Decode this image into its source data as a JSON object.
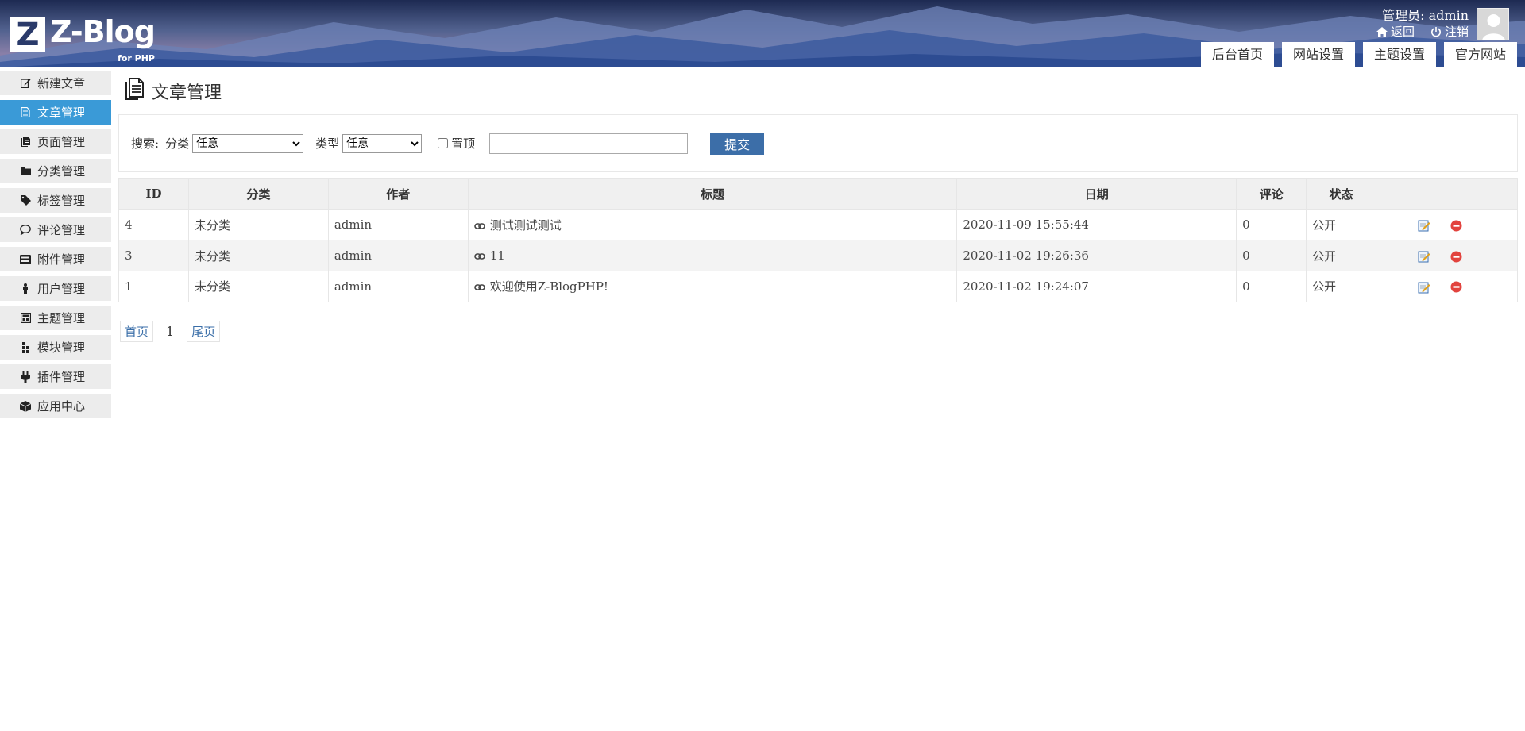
{
  "header": {
    "logo_mark": "Z",
    "logo_text": "Z-Blog",
    "logo_sub": "for PHP",
    "user_label": "管理员: admin",
    "back_label": "返回",
    "logout_label": "注销",
    "tabs": [
      "后台首页",
      "网站设置",
      "主题设置",
      "官方网站"
    ]
  },
  "sidebar": {
    "items": [
      {
        "label": "新建文章",
        "icon": "edit-icon"
      },
      {
        "label": "文章管理",
        "icon": "article-icon"
      },
      {
        "label": "页面管理",
        "icon": "page-icon"
      },
      {
        "label": "分类管理",
        "icon": "folder-icon"
      },
      {
        "label": "标签管理",
        "icon": "tag-icon"
      },
      {
        "label": "评论管理",
        "icon": "comment-icon"
      },
      {
        "label": "附件管理",
        "icon": "attachment-icon"
      },
      {
        "label": "用户管理",
        "icon": "user-icon"
      },
      {
        "label": "主题管理",
        "icon": "theme-icon"
      },
      {
        "label": "模块管理",
        "icon": "module-icon"
      },
      {
        "label": "插件管理",
        "icon": "plugin-icon"
      },
      {
        "label": "应用中心",
        "icon": "box-icon"
      }
    ],
    "active_color": "#3a9ad7"
  },
  "main": {
    "title": "文章管理",
    "search": {
      "label": "搜索:",
      "category_label": "分类",
      "category_value": "任意",
      "type_label": "类型",
      "type_value": "任意",
      "sticky_label": "置顶",
      "keyword_value": "",
      "submit_label": "提交"
    },
    "table": {
      "headers": [
        "ID",
        "分类",
        "作者",
        "标题",
        "日期",
        "评论",
        "状态",
        ""
      ],
      "rows": [
        {
          "id": "4",
          "category": "未分类",
          "author": "admin",
          "title": "测试测试测试",
          "date": "2020-11-09 15:55:44",
          "comments": "0",
          "status": "公开"
        },
        {
          "id": "3",
          "category": "未分类",
          "author": "admin",
          "title": "11",
          "date": "2020-11-02 19:26:36",
          "comments": "0",
          "status": "公开"
        },
        {
          "id": "1",
          "category": "未分类",
          "author": "admin",
          "title": "欢迎使用Z-BlogPHP!",
          "date": "2020-11-02 19:24:07",
          "comments": "0",
          "status": "公开"
        }
      ]
    },
    "pager": {
      "first_label": "首页",
      "current": "1",
      "last_label": "尾页"
    }
  }
}
